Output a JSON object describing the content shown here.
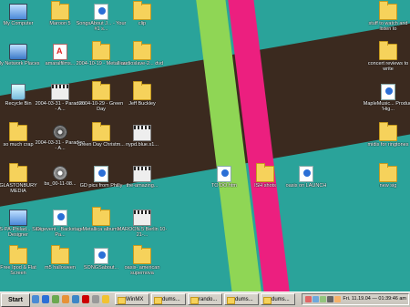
{
  "desktop": {
    "icons": [
      {
        "label": "My Computer",
        "type": "computer"
      },
      {
        "label": "Maroon 5",
        "type": "folder"
      },
      {
        "label": "SongsAbout J... - Your #1 s...",
        "type": "doc"
      },
      {
        "label": "clip",
        "type": "folder"
      },
      {
        "label": "stuff to watch and listen to",
        "type": "folder"
      },
      {
        "label": "My Network Places",
        "type": "network"
      },
      {
        "label": "amaralfilms...",
        "type": "pdf"
      },
      {
        "label": "2004-10-19 - Metallica",
        "type": "folder"
      },
      {
        "label": "audioslave-2... dvd",
        "type": "folder"
      },
      {
        "label": "concert reviews to write",
        "type": "folder"
      },
      {
        "label": "Recycle Bin",
        "type": "recycle"
      },
      {
        "label": "2004-03-31 - Paradiso - A...",
        "type": "media"
      },
      {
        "label": "2004-10-29 - Green Day",
        "type": "folder"
      },
      {
        "label": "Jeff Buckley",
        "type": "folder"
      },
      {
        "label": "MapleMusic... Product 'Hig...",
        "type": "doc"
      },
      {
        "label": "so much crap",
        "type": "folder"
      },
      {
        "label": "2004-03-31 - Paradiso - A...",
        "type": "film"
      },
      {
        "label": "Green Day Christm...",
        "type": "folder"
      },
      {
        "label": "nypd.blue.s1...",
        "type": "media"
      },
      {
        "label": "midis for ringtones",
        "type": "folder"
      },
      {
        "label": "GLASTONBURY MEDIA",
        "type": "folder"
      },
      {
        "label": "bs_00-11-08...",
        "type": "music"
      },
      {
        "label": "GD pics from Philly",
        "type": "doc"
      },
      {
        "label": "the-amazing...",
        "type": "media"
      },
      {
        "label": "TO DO.htm",
        "type": "doc"
      },
      {
        "label": "ISH shots",
        "type": "folder"
      },
      {
        "label": "oasis on LAUNCH",
        "type": "doc"
      },
      {
        "label": "new sig",
        "type": "folder"
      },
      {
        "label": "US-PA-Philad... Site Designer",
        "type": "computer"
      },
      {
        "label": "Digevent - Backstage Pa...",
        "type": "doc"
      },
      {
        "label": "Metallica albums",
        "type": "folder"
      },
      {
        "label": "MAROON 5 Berlin 10-21-...",
        "type": "media"
      },
      {
        "label": "Free Ipod & Flat Screen",
        "type": "folder"
      },
      {
        "label": "m5 halloween",
        "type": "folder"
      },
      {
        "label": "SONGSabout...",
        "type": "doc"
      },
      {
        "label": "oasis- american supernova",
        "type": "folder"
      }
    ]
  },
  "taskbar": {
    "start_label": "Start",
    "tasks": [
      "WinMX",
      "dums...",
      "rando...",
      "dums...",
      "dums..."
    ],
    "clock": "Fri. 11.19.04 — 01:39:46 am"
  }
}
